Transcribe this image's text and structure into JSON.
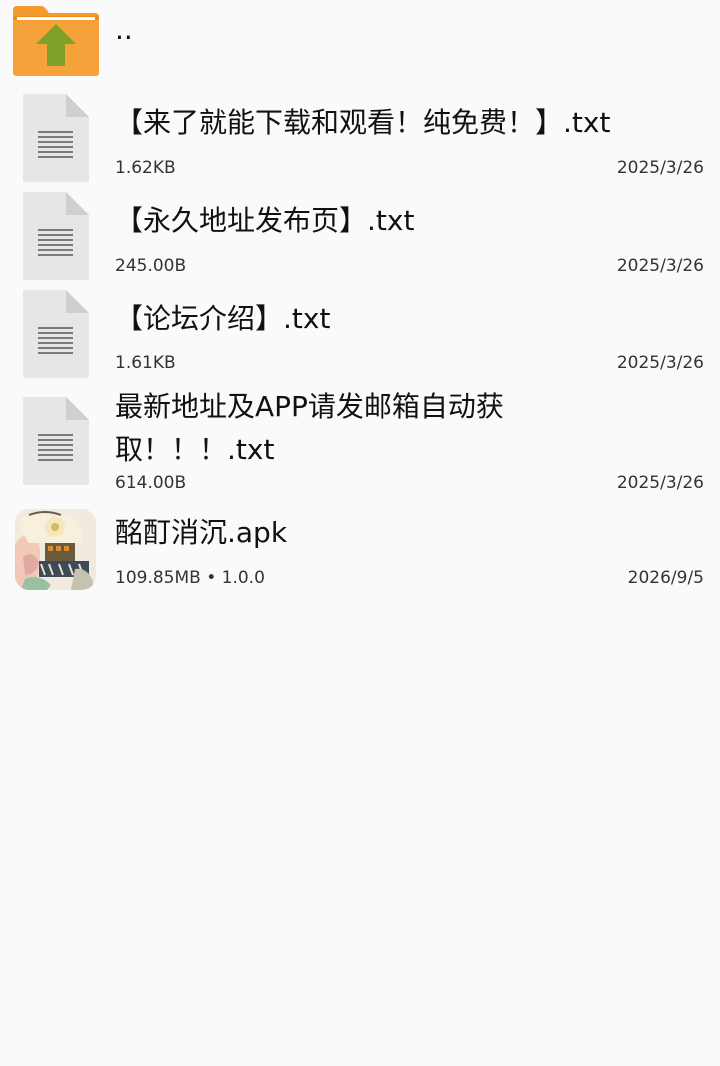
{
  "parent": {
    "label": ".."
  },
  "files": [
    {
      "name": "【来了就能下载和观看！纯免费！】.txt",
      "size": "1.62KB",
      "date": "2025/3/26"
    },
    {
      "name": "【永久地址发布页】.txt",
      "size": "245.00B",
      "date": "2025/3/26"
    },
    {
      "name": "【论坛介绍】.txt",
      "size": "1.61KB",
      "date": "2025/3/26"
    },
    {
      "name_line1": "最新地址及APP请发邮箱自动获",
      "name_line2": "取！！！.txt",
      "size": "614.00B",
      "date": "2025/3/26"
    }
  ],
  "app": {
    "name": "酩酊消沉.apk",
    "size_version": "109.85MB  •  1.0.0",
    "date": "2026/9/5"
  },
  "icons": {
    "parent": "folder-up-icon",
    "text_file": "text-file-icon",
    "app": "app-icon"
  },
  "colors": {
    "folder_orange": "#f39c2d",
    "folder_arrow": "#7fa12a",
    "file_gray": "#e6e6e6",
    "background": "#fafafa"
  }
}
